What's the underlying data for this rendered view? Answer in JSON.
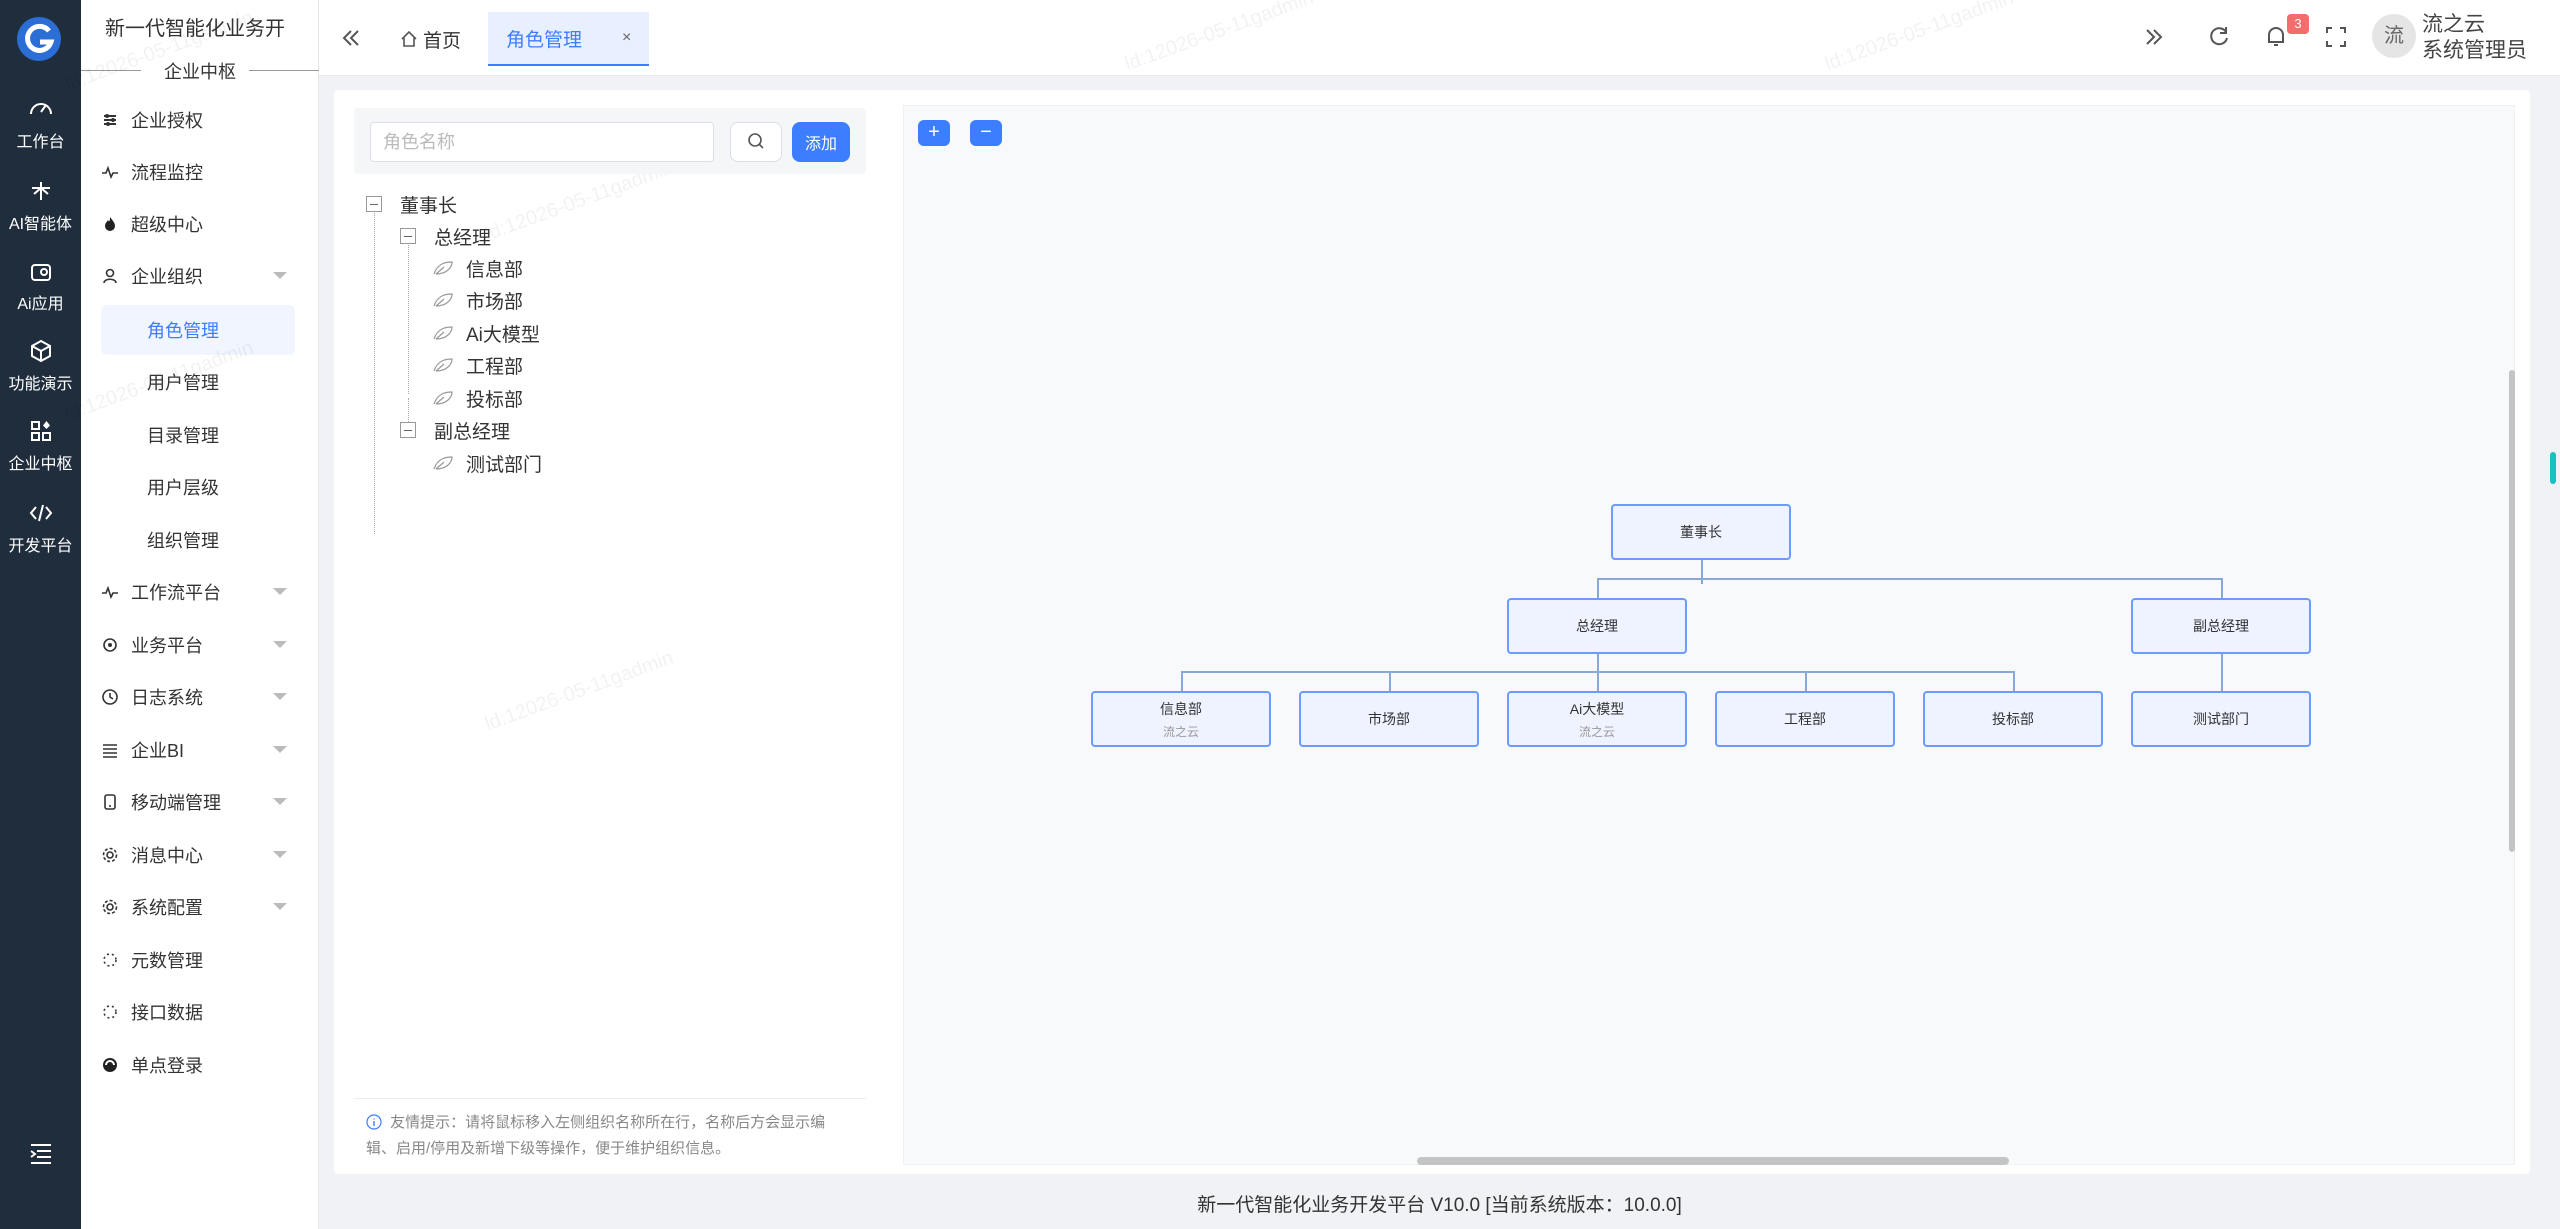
{
  "app": {
    "title": "新一代智能化业务开",
    "section": "企业中枢"
  },
  "rail": {
    "items": [
      {
        "label": "工作台",
        "icon": "dashboard-icon"
      },
      {
        "label": "AI智能体",
        "icon": "agent-icon"
      },
      {
        "label": "Ai应用",
        "icon": "app-icon"
      },
      {
        "label": "功能演示",
        "icon": "cube-icon"
      },
      {
        "label": "企业中枢",
        "icon": "grid-icon"
      },
      {
        "label": "开发平台",
        "icon": "code-icon"
      }
    ]
  },
  "menu": {
    "items": [
      {
        "label": "企业授权",
        "icon": "sliders-icon",
        "expandable": false
      },
      {
        "label": "流程监控",
        "icon": "pulse-icon",
        "expandable": false
      },
      {
        "label": "超级中心",
        "icon": "flame-icon",
        "expandable": false
      },
      {
        "label": "企业组织",
        "icon": "user-icon",
        "expandable": true
      },
      {
        "label": "工作流平台",
        "icon": "pulse-icon",
        "expandable": true
      },
      {
        "label": "业务平台",
        "icon": "circle-icon",
        "expandable": true
      },
      {
        "label": "日志系统",
        "icon": "clock-icon",
        "expandable": true
      },
      {
        "label": "企业BI",
        "icon": "list-icon",
        "expandable": true
      },
      {
        "label": "移动端管理",
        "icon": "mobile-icon",
        "expandable": true
      },
      {
        "label": "消息中心",
        "icon": "gear-icon",
        "expandable": true
      },
      {
        "label": "系统配置",
        "icon": "gear-icon",
        "expandable": true
      },
      {
        "label": "元数管理",
        "icon": "loader-icon",
        "expandable": false
      },
      {
        "label": "接口数据",
        "icon": "loader-icon",
        "expandable": false
      },
      {
        "label": "单点登录",
        "icon": "sso-icon",
        "expandable": false
      }
    ],
    "sub_items": [
      {
        "label": "角色管理",
        "active": true
      },
      {
        "label": "用户管理",
        "active": false
      },
      {
        "label": "目录管理",
        "active": false
      },
      {
        "label": "用户层级",
        "active": false
      },
      {
        "label": "组织管理",
        "active": false
      }
    ]
  },
  "topbar": {
    "tabs": [
      {
        "label": "首页",
        "active": false
      },
      {
        "label": "角色管理",
        "active": true,
        "closable": "×"
      }
    ],
    "notification_count": "3",
    "avatar_text": "流",
    "user_name": "流之云",
    "user_role": "系统管理员"
  },
  "tree_panel": {
    "search_placeholder": "角色名称",
    "search_value": "",
    "add_label": "添加",
    "nodes": [
      {
        "label": "董事长",
        "level": 0,
        "type": "branch"
      },
      {
        "label": "总经理",
        "level": 1,
        "type": "branch"
      },
      {
        "label": "信息部",
        "level": 2,
        "type": "leaf"
      },
      {
        "label": "市场部",
        "level": 2,
        "type": "leaf"
      },
      {
        "label": "Ai大模型",
        "level": 2,
        "type": "leaf"
      },
      {
        "label": "工程部",
        "level": 2,
        "type": "leaf"
      },
      {
        "label": "投标部",
        "level": 2,
        "type": "leaf"
      },
      {
        "label": "副总经理",
        "level": 1,
        "type": "branch"
      },
      {
        "label": "测试部门",
        "level": 2,
        "type": "leaf"
      }
    ],
    "tip": "友情提示：请将鼠标移入左侧组织名称所在行，名称后方会显示编辑、启用/停用及新增下级等操作，便于维护组织信息。"
  },
  "org_chart": {
    "zoom_in": "+",
    "zoom_out": "−",
    "root": {
      "label": "董事长",
      "sub": ""
    },
    "level1": [
      {
        "label": "总经理",
        "sub": ""
      },
      {
        "label": "副总经理",
        "sub": ""
      }
    ],
    "level2": [
      {
        "label": "信息部",
        "sub": "流之云"
      },
      {
        "label": "市场部",
        "sub": ""
      },
      {
        "label": "Ai大模型",
        "sub": "流之云"
      },
      {
        "label": "工程部",
        "sub": ""
      },
      {
        "label": "投标部",
        "sub": ""
      },
      {
        "label": "测试部门",
        "sub": ""
      }
    ]
  },
  "footer": {
    "text": "新一代智能化业务开发平台 V10.0 [当前系统版本：10.0.0]"
  },
  "colors": {
    "accent": "#3d7dff",
    "rail_bg": "#1f2d3d",
    "node_border": "#6b9bff",
    "node_bg": "#eef3ff",
    "badge": "#f56c6c"
  }
}
